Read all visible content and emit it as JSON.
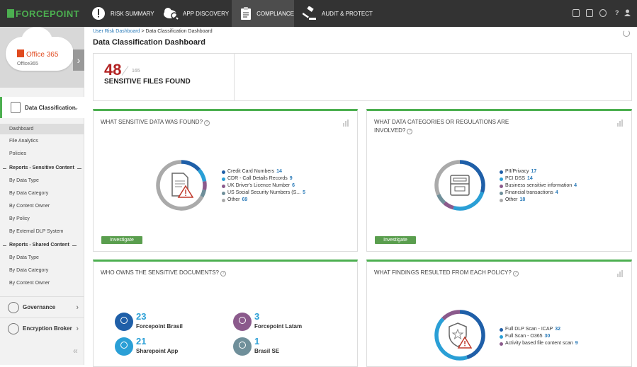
{
  "brand": "FORCEPOINT",
  "nav": [
    {
      "label": "RISK SUMMARY",
      "icon": "alert-icon"
    },
    {
      "label": "APP DISCOVERY",
      "icon": "cloud-search-icon"
    },
    {
      "label": "COMPLIANCE",
      "icon": "clipboard-icon",
      "active": true
    },
    {
      "label": "AUDIT & PROTECT",
      "icon": "gavel-icon"
    }
  ],
  "topbar_right": {
    "help": "?"
  },
  "app": {
    "title": "Office 365",
    "subtitle": "Office365"
  },
  "sidebar": {
    "section": "Data Classification",
    "links": [
      "Dashboard",
      "File Analytics",
      "Policies"
    ],
    "group1": "Reports - Sensitive Content",
    "group1_links": [
      "By Data Type",
      "By Data Category",
      "By Content Owner",
      "By Policy",
      "By External DLP System"
    ],
    "group2": "Reports - Shared Content",
    "group2_links": [
      "By Data Type",
      "By Data Category",
      "By Content Owner"
    ],
    "governance": "Governance",
    "encryption": "Encryption Broker"
  },
  "breadcrumb": {
    "root": "User Risk Dashboard",
    "sep": " > ",
    "current": "Data Classification Dashboard"
  },
  "page_title": "Data Classification Dashboard",
  "summary": {
    "count": "48",
    "total": "165",
    "label": "SENSITIVE FILES FOUND"
  },
  "panels": {
    "found": {
      "title": "WHAT SENSITIVE DATA WAS FOUND?",
      "button": "Investigate",
      "items": [
        {
          "label": "Credit Card Numbers",
          "value": "14",
          "color": "#1f5fa8"
        },
        {
          "label": "CDR - Call Details Records",
          "value": "9",
          "color": "#2a9fd6"
        },
        {
          "label": "UK Driver's Licence Number",
          "value": "6",
          "color": "#8b5a8c"
        },
        {
          "label": "US Social Security Numbers (S...",
          "value": "5",
          "color": "#6f8f9a"
        },
        {
          "label": "Other",
          "value": "69",
          "color": "#aaaaaa"
        }
      ]
    },
    "categories": {
      "title_line1": "WHAT DATA CATEGORIES OR REGULATIONS ARE",
      "title_line2": "INVOLVED?",
      "button": "Investigate",
      "items": [
        {
          "label": "PII/Privacy",
          "value": "17",
          "color": "#1f5fa8"
        },
        {
          "label": "PCI DSS",
          "value": "14",
          "color": "#2a9fd6"
        },
        {
          "label": "Business sensitive information",
          "value": "4",
          "color": "#8b5a8c"
        },
        {
          "label": "Financial transactions",
          "value": "4",
          "color": "#6f8f9a"
        },
        {
          "label": "Other",
          "value": "18",
          "color": "#aaaaaa"
        }
      ]
    },
    "owners": {
      "title": "WHO OWNS THE SENSITIVE DOCUMENTS?",
      "items": [
        {
          "name": "Forcepoint Brasil",
          "value": "23",
          "color": "#1f5fa8"
        },
        {
          "name": "Forcepoint Latam",
          "value": "3",
          "color": "#8b5a8c"
        },
        {
          "name": "Sharepoint App",
          "value": "21",
          "color": "#2a9fd6"
        },
        {
          "name": "Brasil SE",
          "value": "1",
          "color": "#6f8f9a"
        }
      ]
    },
    "policy": {
      "title": "WHAT FINDINGS RESULTED FROM EACH POLICY?",
      "items": [
        {
          "label": "Full DLP Scan - ICAP",
          "value": "32",
          "color": "#1f5fa8"
        },
        {
          "label": "Full Scan - O365",
          "value": "30",
          "color": "#2a9fd6"
        },
        {
          "label": "Activity based file content scan",
          "value": "9",
          "color": "#8b5a8c"
        }
      ]
    }
  }
}
